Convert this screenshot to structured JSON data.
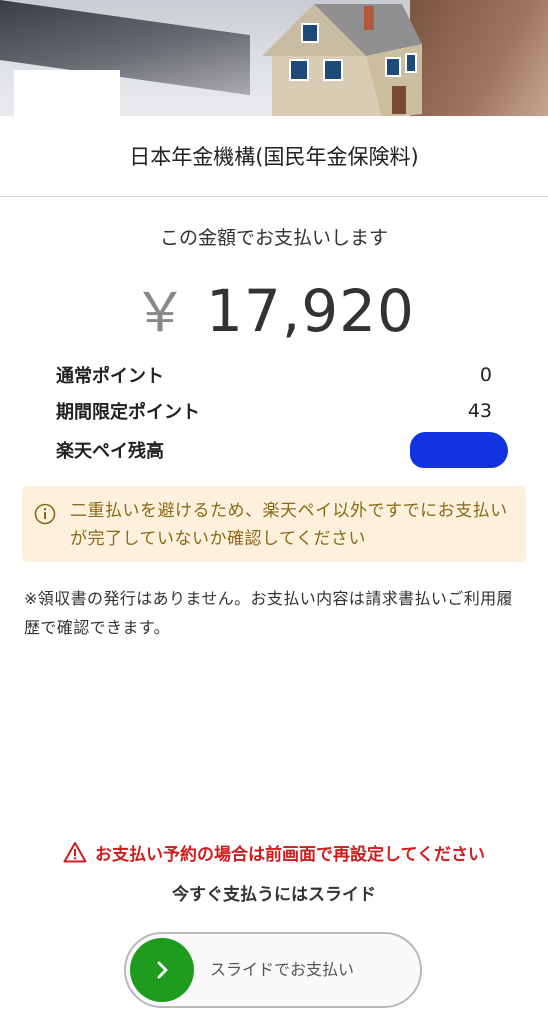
{
  "header": {
    "payee": "日本年金機構(国民年金保険料)"
  },
  "payment": {
    "subtitle": "この金額でお支払いします",
    "currency_symbol": "￥",
    "amount": "17,920"
  },
  "points": [
    {
      "label": "通常ポイント",
      "value": "0"
    },
    {
      "label": "期間限定ポイント",
      "value": "43"
    },
    {
      "label": "楽天ペイ残高",
      "value": ""
    }
  ],
  "notice": {
    "icon": "info-circle-icon",
    "text": "二重払いを避けるため、楽天ペイ以外ですでにお支払いが完了していないか確認してください"
  },
  "note": "※領収書の発行はありません。お支払い内容は請求書払いご利用履歴で確認できます。",
  "warning": {
    "icon": "warning-triangle-icon",
    "text": "お支払い予約の場合は前画面で再設定してください"
  },
  "slide": {
    "instruction": "今すぐ支払うにはスライド",
    "button_label": "スライドでお支払い",
    "knob_icon": "chevron-right-icon"
  },
  "colors": {
    "notice_bg": "#fdf0dd",
    "notice_text": "#8a6a16",
    "warning": "#cf1d1d",
    "slider_knob": "#1e9c1e"
  }
}
